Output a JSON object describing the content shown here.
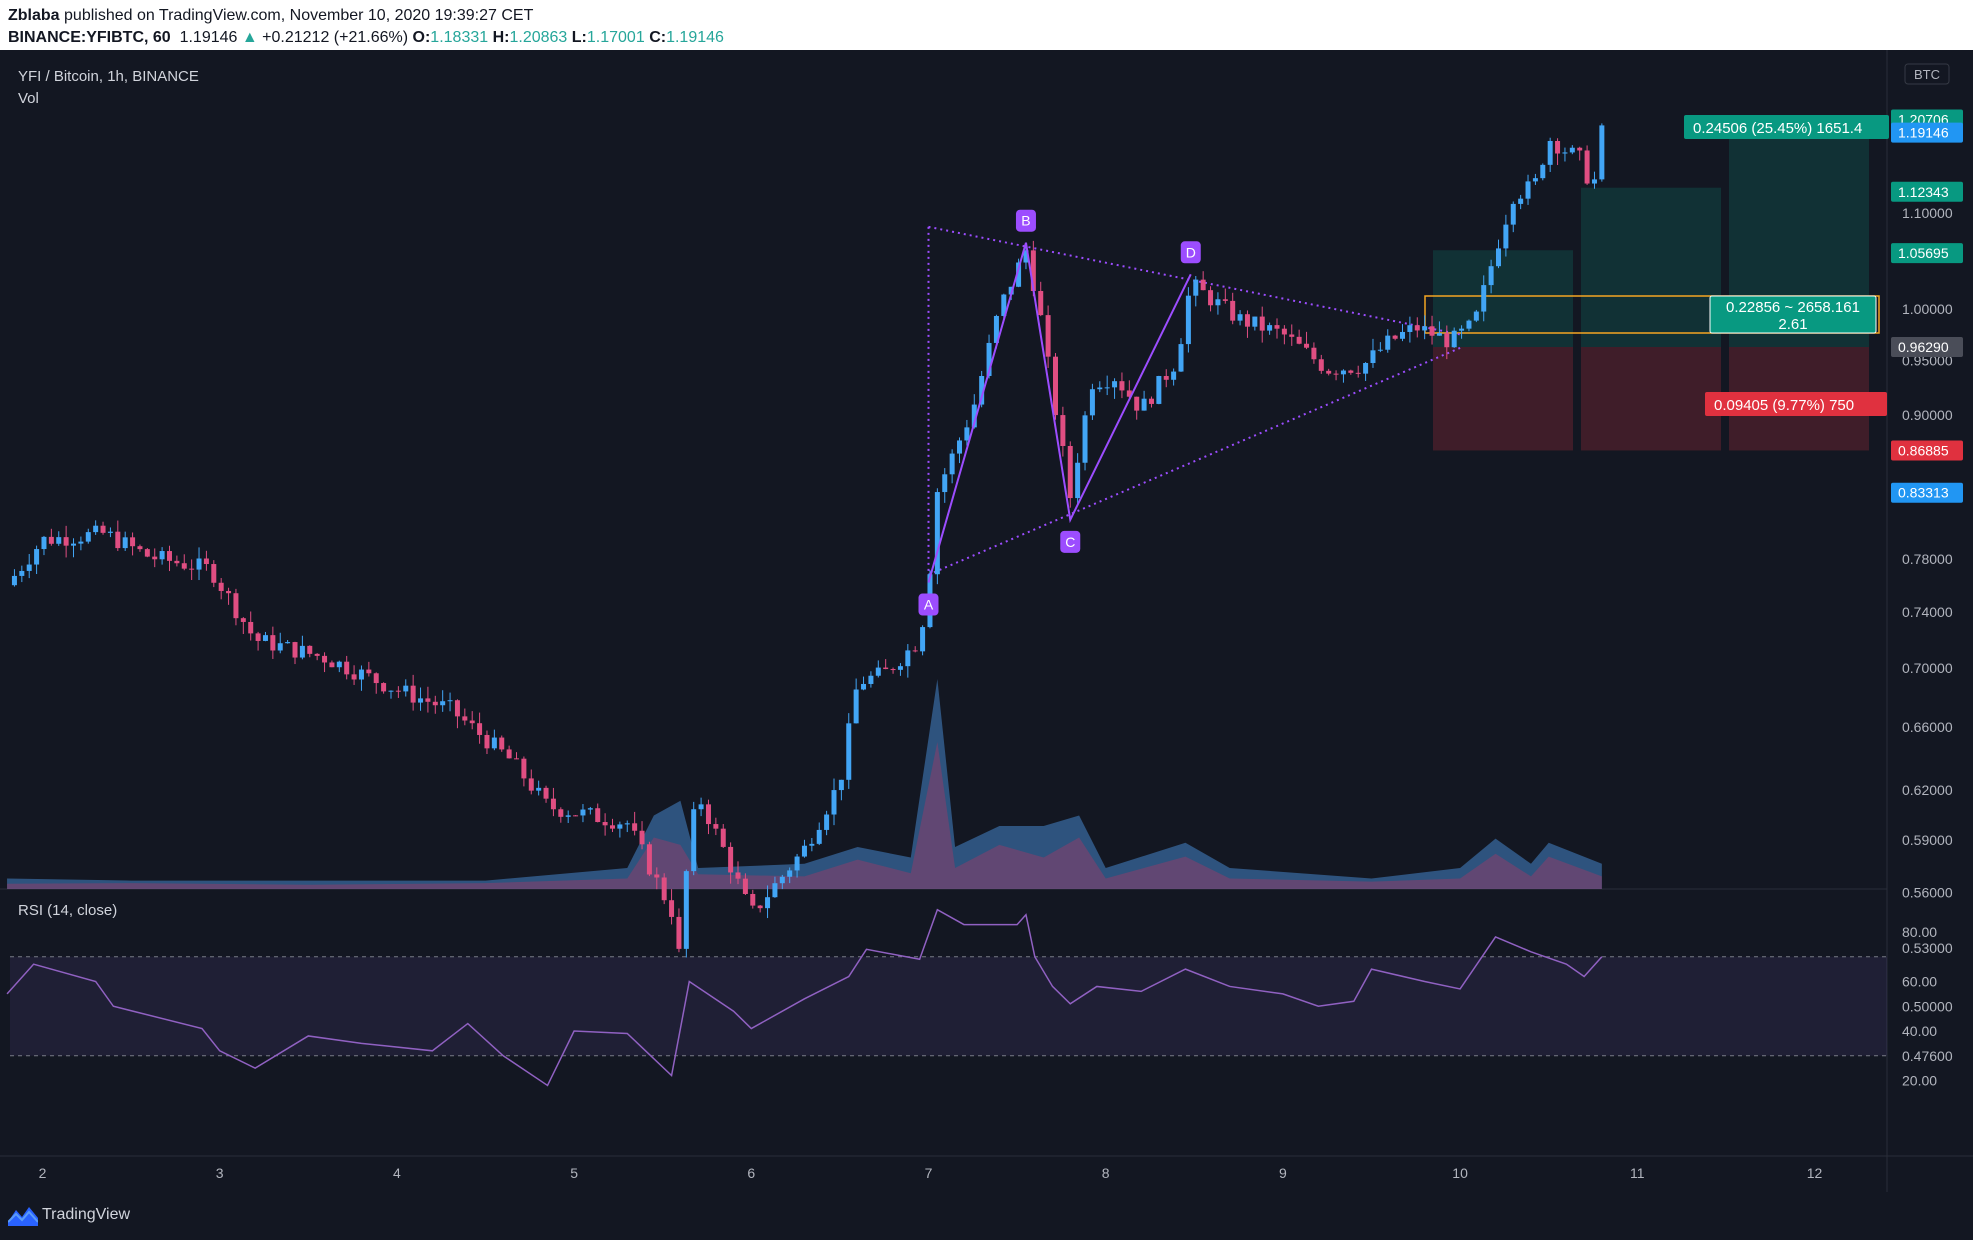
{
  "header": {
    "author": "Zblaba",
    "published": "published on TradingView.com, November 10, 2020 19:39:27 CET",
    "symbol": "BINANCE:YFIBTC, 60",
    "last": "1.19146",
    "change": "+0.21212 (+21.66%)",
    "o_label": "O:",
    "o_val": "1.18331",
    "h_label": "H:",
    "h_val": "1.20863",
    "l_label": "L:",
    "l_val": "1.17001",
    "c_label": "C:",
    "c_val": "1.19146"
  },
  "pane_titles": {
    "main": "YFI / Bitcoin, 1h, BINANCE",
    "vol": "Vol",
    "rsi": "RSI (14, close)",
    "currency": "BTC"
  },
  "pattern_labels": [
    "A",
    "B",
    "C",
    "D"
  ],
  "position_labels": {
    "target": "0.24506 (25.45%) 1651.4",
    "risk_reward": "0.22856 ~ 2658.161",
    "ratio": "2.61",
    "stop": "0.09405 (9.77%) 750"
  },
  "price_tags": {
    "last": "1.19146",
    "t1": "1.12343",
    "t2": "1.05695",
    "entry": "0.96290",
    "stop": "0.86885",
    "low": "0.83313",
    "hidden_top": "1.20706"
  },
  "footer": {
    "brand": "TradingView"
  },
  "colors": {
    "bg": "#131722",
    "up": "#42a5f5",
    "down": "#e04e82",
    "pattern": "#9c4dff",
    "rsi": "#9061c2",
    "profit": "#089981",
    "loss": "#f23645"
  },
  "chart_data": {
    "type": "candlestick",
    "x_ticks": [
      "2",
      "3",
      "4",
      "5",
      "6",
      "7",
      "8",
      "9",
      "10",
      "11",
      "12"
    ],
    "y_ticks": [
      "1.10000",
      "1.00000",
      "0.95000",
      "0.90000",
      "0.78000",
      "0.74000",
      "0.70000",
      "0.66000",
      "0.62000",
      "0.59000",
      "0.56000",
      "0.53000",
      "0.50000",
      "0.47600"
    ],
    "y_tick_values": [
      1.1,
      1.0,
      0.95,
      0.9,
      0.78,
      0.74,
      0.7,
      0.66,
      0.62,
      0.59,
      0.56,
      0.53,
      0.5,
      0.476
    ],
    "ylim": [
      0.4614,
      1.2542
    ],
    "y_scale": "log",
    "rsi_ticks": [
      "80.00",
      "60.00",
      "40.00",
      "20.00"
    ],
    "rsi_tick_values": [
      80,
      60,
      40,
      20
    ],
    "rsi_band": [
      30,
      70
    ],
    "pattern_points": [
      {
        "label": "A",
        "day": 7.0,
        "price": 0.762
      },
      {
        "label": "B",
        "day": 7.55,
        "price": 1.068
      },
      {
        "label": "C",
        "day": 7.8,
        "price": 0.811
      },
      {
        "label": "D",
        "day": 8.48,
        "price": 1.035
      }
    ],
    "triangle_upper": [
      {
        "day": 7.0,
        "price": 1.085
      },
      {
        "day": 10.0,
        "price": 0.975
      }
    ],
    "triangle_lower": [
      {
        "day": 7.0,
        "price": 0.768
      },
      {
        "day": 10.0,
        "price": 0.962
      }
    ],
    "long_position": {
      "entry": 0.9629,
      "target": 1.20796,
      "stop": 0.86885
    },
    "close_path": [
      {
        "day": 1.8,
        "price": 0.76
      },
      {
        "day": 2.0,
        "price": 0.795
      },
      {
        "day": 2.35,
        "price": 0.8
      },
      {
        "day": 2.6,
        "price": 0.782
      },
      {
        "day": 2.95,
        "price": 0.772
      },
      {
        "day": 3.2,
        "price": 0.72
      },
      {
        "day": 3.6,
        "price": 0.707
      },
      {
        "day": 4.0,
        "price": 0.685
      },
      {
        "day": 4.3,
        "price": 0.672
      },
      {
        "day": 4.65,
        "price": 0.638
      },
      {
        "day": 4.85,
        "price": 0.61
      },
      {
        "day": 5.3,
        "price": 0.6
      },
      {
        "day": 5.55,
        "price": 0.55
      },
      {
        "day": 5.58,
        "price": 0.515
      },
      {
        "day": 5.65,
        "price": 0.59
      },
      {
        "day": 5.7,
        "price": 0.617
      },
      {
        "day": 5.85,
        "price": 0.583
      },
      {
        "day": 6.0,
        "price": 0.548
      },
      {
        "day": 6.1,
        "price": 0.56
      },
      {
        "day": 6.3,
        "price": 0.585
      },
      {
        "day": 6.5,
        "price": 0.625
      },
      {
        "day": 6.6,
        "price": 0.69
      },
      {
        "day": 6.75,
        "price": 0.696
      },
      {
        "day": 6.95,
        "price": 0.72
      },
      {
        "day": 7.0,
        "price": 0.762
      },
      {
        "day": 7.05,
        "price": 0.835
      },
      {
        "day": 7.25,
        "price": 0.905
      },
      {
        "day": 7.4,
        "price": 1.0
      },
      {
        "day": 7.55,
        "price": 1.06
      },
      {
        "day": 7.62,
        "price": 1.005
      },
      {
        "day": 7.7,
        "price": 0.92
      },
      {
        "day": 7.8,
        "price": 0.83
      },
      {
        "day": 7.92,
        "price": 0.93
      },
      {
        "day": 8.05,
        "price": 0.935
      },
      {
        "day": 8.2,
        "price": 0.905
      },
      {
        "day": 8.4,
        "price": 0.95
      },
      {
        "day": 8.48,
        "price": 1.025
      },
      {
        "day": 8.75,
        "price": 0.99
      },
      {
        "day": 9.0,
        "price": 0.975
      },
      {
        "day": 9.25,
        "price": 0.942
      },
      {
        "day": 9.45,
        "price": 0.945
      },
      {
        "day": 9.6,
        "price": 0.968
      },
      {
        "day": 9.75,
        "price": 0.982
      },
      {
        "day": 9.95,
        "price": 0.968
      },
      {
        "day": 10.08,
        "price": 0.985
      },
      {
        "day": 10.2,
        "price": 1.06
      },
      {
        "day": 10.3,
        "price": 1.12
      },
      {
        "day": 10.42,
        "price": 1.13
      },
      {
        "day": 10.5,
        "price": 1.185
      },
      {
        "day": 10.6,
        "price": 1.17
      },
      {
        "day": 10.68,
        "price": 1.16
      },
      {
        "day": 10.75,
        "price": 1.125
      },
      {
        "day": 10.8,
        "price": 1.191
      }
    ],
    "volume_path": [
      {
        "day": 1.8,
        "v": 0.05
      },
      {
        "day": 2.5,
        "v": 0.04
      },
      {
        "day": 3.5,
        "v": 0.04
      },
      {
        "day": 4.5,
        "v": 0.04
      },
      {
        "day": 5.3,
        "v": 0.1
      },
      {
        "day": 5.45,
        "v": 0.35
      },
      {
        "day": 5.6,
        "v": 0.42
      },
      {
        "day": 5.7,
        "v": 0.1
      },
      {
        "day": 6.3,
        "v": 0.12
      },
      {
        "day": 6.6,
        "v": 0.2
      },
      {
        "day": 6.9,
        "v": 0.15
      },
      {
        "day": 7.05,
        "v": 1.0
      },
      {
        "day": 7.15,
        "v": 0.2
      },
      {
        "day": 7.4,
        "v": 0.3
      },
      {
        "day": 7.65,
        "v": 0.3
      },
      {
        "day": 7.85,
        "v": 0.35
      },
      {
        "day": 8.0,
        "v": 0.1
      },
      {
        "day": 8.45,
        "v": 0.22
      },
      {
        "day": 8.7,
        "v": 0.1
      },
      {
        "day": 9.5,
        "v": 0.05
      },
      {
        "day": 10.0,
        "v": 0.1
      },
      {
        "day": 10.2,
        "v": 0.24
      },
      {
        "day": 10.4,
        "v": 0.12
      },
      {
        "day": 10.5,
        "v": 0.22
      },
      {
        "day": 10.8,
        "v": 0.12
      }
    ],
    "rsi_path": [
      {
        "day": 1.8,
        "r": 55
      },
      {
        "day": 1.95,
        "r": 67
      },
      {
        "day": 2.3,
        "r": 60
      },
      {
        "day": 2.4,
        "r": 50
      },
      {
        "day": 2.9,
        "r": 41
      },
      {
        "day": 3.0,
        "r": 32
      },
      {
        "day": 3.2,
        "r": 25
      },
      {
        "day": 3.5,
        "r": 38
      },
      {
        "day": 3.8,
        "r": 35
      },
      {
        "day": 4.2,
        "r": 32
      },
      {
        "day": 4.4,
        "r": 43
      },
      {
        "day": 4.6,
        "r": 30
      },
      {
        "day": 4.85,
        "r": 18
      },
      {
        "day": 5.0,
        "r": 40
      },
      {
        "day": 5.3,
        "r": 39
      },
      {
        "day": 5.55,
        "r": 22
      },
      {
        "day": 5.65,
        "r": 60
      },
      {
        "day": 5.9,
        "r": 48
      },
      {
        "day": 6.0,
        "r": 41
      },
      {
        "day": 6.3,
        "r": 53
      },
      {
        "day": 6.55,
        "r": 62
      },
      {
        "day": 6.65,
        "r": 73
      },
      {
        "day": 6.95,
        "r": 69
      },
      {
        "day": 7.05,
        "r": 89
      },
      {
        "day": 7.2,
        "r": 83
      },
      {
        "day": 7.5,
        "r": 83
      },
      {
        "day": 7.55,
        "r": 87
      },
      {
        "day": 7.6,
        "r": 70
      },
      {
        "day": 7.7,
        "r": 58
      },
      {
        "day": 7.8,
        "r": 51
      },
      {
        "day": 7.95,
        "r": 58
      },
      {
        "day": 8.2,
        "r": 56
      },
      {
        "day": 8.45,
        "r": 65
      },
      {
        "day": 8.7,
        "r": 58
      },
      {
        "day": 9.0,
        "r": 55
      },
      {
        "day": 9.2,
        "r": 50
      },
      {
        "day": 9.4,
        "r": 52
      },
      {
        "day": 9.5,
        "r": 65
      },
      {
        "day": 9.8,
        "r": 60
      },
      {
        "day": 10.0,
        "r": 57
      },
      {
        "day": 10.2,
        "r": 78
      },
      {
        "day": 10.4,
        "r": 72
      },
      {
        "day": 10.6,
        "r": 67
      },
      {
        "day": 10.7,
        "r": 62
      },
      {
        "day": 10.8,
        "r": 70
      }
    ]
  }
}
